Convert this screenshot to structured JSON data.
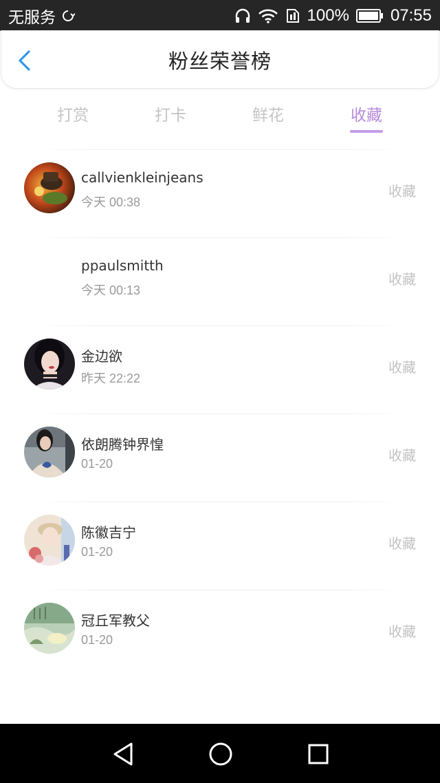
{
  "status_bar": {
    "carrier": "无服务",
    "battery": "100%",
    "time": "07:55"
  },
  "header": {
    "title": "粉丝荣誉榜",
    "back_icon": "chevron-left-icon"
  },
  "tabs": [
    {
      "label": "打赏",
      "active": false
    },
    {
      "label": "打卡",
      "active": false
    },
    {
      "label": "鲜花",
      "active": false
    },
    {
      "label": "收藏",
      "active": true
    }
  ],
  "colors": {
    "accent": "#b78bd9",
    "tab_inactive": "#c4c4c4",
    "action_text": "#c2c2c2"
  },
  "fans": [
    {
      "name": "callvienkleinjeans",
      "time": "今天 00:38",
      "action": "收藏",
      "avatar": "game-avatar"
    },
    {
      "name": "ppaulsmitth",
      "time": "今天 00:13",
      "action": "收藏",
      "avatar": "blank-avatar"
    },
    {
      "name": "金边欲",
      "time": "昨天 22:22",
      "action": "收藏",
      "avatar": "girl-portrait-avatar"
    },
    {
      "name": "依朗腾钟界惶",
      "time": "01-20",
      "action": "收藏",
      "avatar": "girl-sweater-avatar"
    },
    {
      "name": "陈徽吉宁",
      "time": "01-20",
      "action": "收藏",
      "avatar": "girl-flower-avatar"
    },
    {
      "name": "冠丘军教父",
      "time": "01-20",
      "action": "收藏",
      "avatar": "landscape-avatar"
    }
  ],
  "nav": [
    "back-triangle-icon",
    "home-circle-icon",
    "recents-square-icon"
  ]
}
